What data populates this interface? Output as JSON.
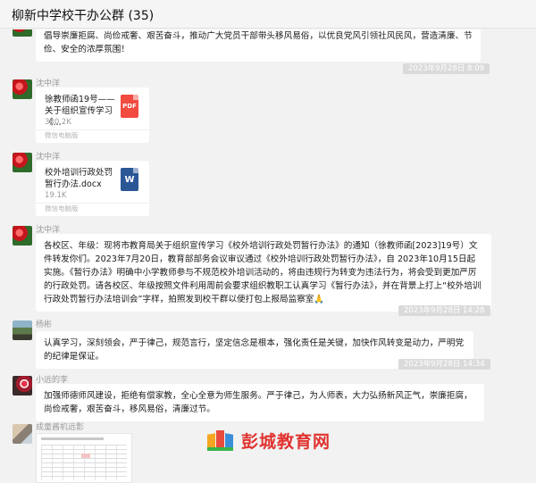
{
  "window": {
    "title": "柳新中学校干办公群 (35)"
  },
  "messages": {
    "m0": {
      "text": "倡导崇廉拒腐、尚俭戒奢、艰苦奋斗，推动广大党员干部带头移风易俗，以优良党风引领社风民风，营造清廉、节俭、安全的浓厚氛围！"
    },
    "t1": "2023年9月28日 8:09",
    "m1": {
      "sender": "沈中洋",
      "file": {
        "name": "徐教师函19号——关于组织宣传学习《...",
        "size": "330.2K",
        "source": "微信电脑版",
        "type": "PDF"
      }
    },
    "m2": {
      "sender": "沈中洋",
      "file": {
        "name": "校外培训行政处罚暂行办法.docx",
        "size": "19.1K",
        "source": "微信电脑版",
        "type": "W"
      }
    },
    "m3": {
      "sender": "沈中洋",
      "text": "各校区、年级：现将市教育局关于组织宣传学习《校外培训行政处罚暂行办法》的通知（徐教师函[2023]19号）文件转发你们。2023年7月20日，教育部部务会议审议通过《校外培训行政处罚暂行办法》，自 2023年10月15日起实施。《暂行办法》明确中小学教师参与不规范校外培训活动的，将由违规行为转变为违法行为，将会受到更加严厉的行政处罚。请各校区、年级按照文件利用周前会要求组织教职工认真学习《暂行办法》，并在背景上打上“校外培训行政处罚暂行办法培训会”字样，拍照发到校干群以便打包上报局监察室",
      "emoji": "🙏"
    },
    "t2": "2023年9月28日 14:28",
    "m4": {
      "sender": "杨彬",
      "text": "认真学习，深刻领会，严于律己，规范言行，坚定信念是根本，强化责任是关键，加快作风转变是动力，严明党的纪律是保证。"
    },
    "t3": "2023年9月28日 14:34",
    "m5": {
      "sender": "小远的李",
      "text": "加强师德师风建设，拒绝有偿家教，全心全意为师生服务。严于律己，为人师表，大力弘扬新风正气，崇廉拒腐，尚俭戒奢，艰苦奋斗，移风易俗，清廉过节。"
    },
    "m6": {
      "sender": "成童酱机远影"
    }
  },
  "watermark": {
    "text": "彭城教育网"
  }
}
